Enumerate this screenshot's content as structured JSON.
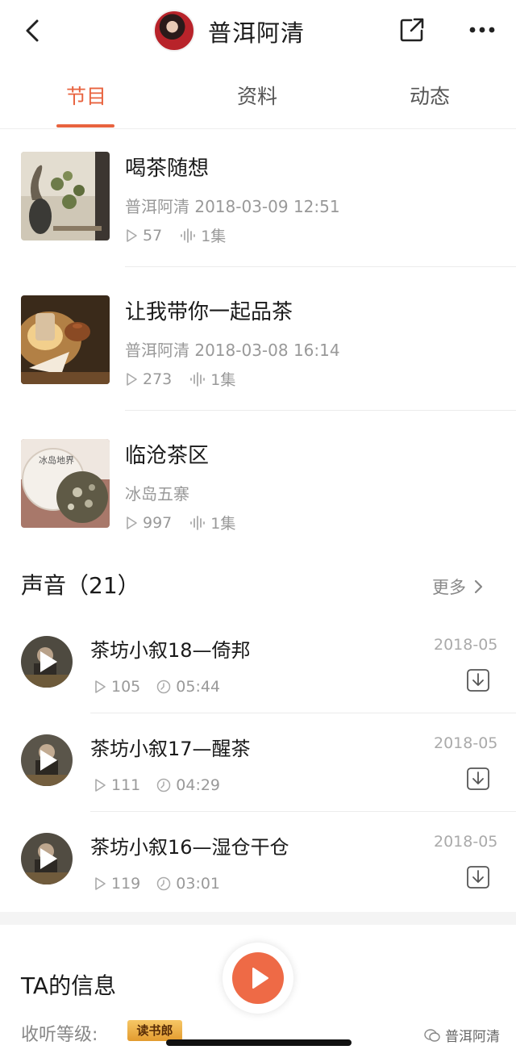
{
  "header": {
    "title": "普洱阿清"
  },
  "tabs": [
    {
      "label": "节目"
    },
    {
      "label": "资料"
    },
    {
      "label": "动态"
    }
  ],
  "programs": [
    {
      "title": "喝茶随想",
      "meta": "普洱阿清 2018-03-09 12:51",
      "plays": "57",
      "episodes": "1集"
    },
    {
      "title": "让我带你一起品茶",
      "meta": "普洱阿清 2018-03-08 16:14",
      "plays": "273",
      "episodes": "1集"
    },
    {
      "title": "临沧茶区",
      "meta": "冰岛五寨",
      "plays": "997",
      "episodes": "1集"
    }
  ],
  "sounds": {
    "title": "声音（21）",
    "more_label": "更多",
    "items": [
      {
        "title": "茶坊小叙18—倚邦",
        "plays": "105",
        "duration": "05:44",
        "date": "2018-05"
      },
      {
        "title": "茶坊小叙17—醒茶",
        "plays": "111",
        "duration": "04:29",
        "date": "2018-05"
      },
      {
        "title": "茶坊小叙16—湿仓干仓",
        "plays": "119",
        "duration": "03:01",
        "date": "2018-05"
      }
    ]
  },
  "ta_info": {
    "title": "TA的信息",
    "level_label": "收听等级:",
    "level_badge": "读书郎"
  },
  "thumb3_text": "冰岛地界",
  "watermark": "普洱阿清",
  "colors": {
    "accent": "#e8633f",
    "play_button": "#ee6a46"
  }
}
